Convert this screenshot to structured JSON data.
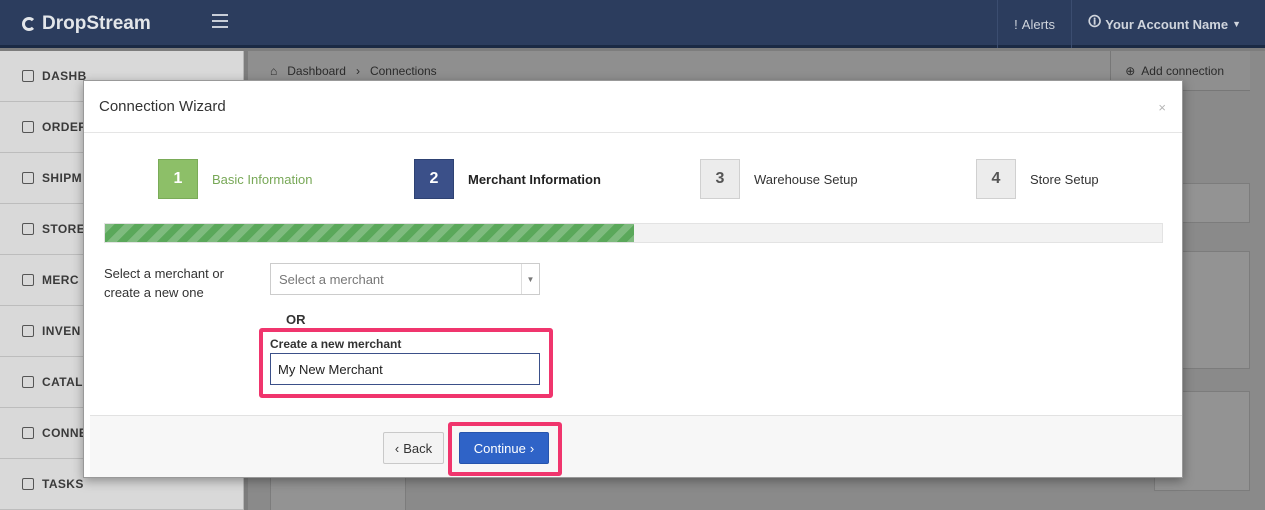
{
  "app": {
    "logo": "DropStream",
    "nav": {
      "alerts": "Alerts",
      "account": "Your Account Name"
    }
  },
  "sidebar": {
    "items": [
      {
        "label": "DASHB",
        "icon": "home-icon"
      },
      {
        "label": "ORDER",
        "icon": "bag-icon"
      },
      {
        "label": "SHIPM",
        "icon": "truck-icon"
      },
      {
        "label": "STORE",
        "icon": "cart-icon"
      },
      {
        "label": "MERC",
        "icon": "users-icon"
      },
      {
        "label": "INVEN",
        "icon": "inventory-icon"
      },
      {
        "label": "CATAL",
        "icon": "book-icon"
      },
      {
        "label": "CONNE",
        "icon": "plug-icon"
      },
      {
        "label": "TASKS",
        "icon": "list-icon"
      }
    ]
  },
  "breadcrumb": {
    "home": "Dashboard",
    "current": "Connections"
  },
  "actions": {
    "add_connection": "Add connection"
  },
  "modal": {
    "title": "Connection Wizard",
    "close": "×",
    "steps": [
      {
        "number": "1",
        "label": "Basic Information",
        "state": "done"
      },
      {
        "number": "2",
        "label": "Merchant Information",
        "state": "active"
      },
      {
        "number": "3",
        "label": "Warehouse Setup",
        "state": "pending"
      },
      {
        "number": "4",
        "label": "Store Setup",
        "state": "pending"
      }
    ],
    "progress_percent": 50,
    "merchant_label": "Select a merchant or create a new one",
    "merchant_select": {
      "placeholder": "Select a merchant"
    },
    "or_label": "OR",
    "new_merchant": {
      "label": "Create a new merchant",
      "value": "My New Merchant"
    },
    "buttons": {
      "back": "Back",
      "continue": "Continue"
    }
  },
  "colors": {
    "navbar": "#2c3d5e",
    "step_done": "#8dbf68",
    "step_active": "#3b5089",
    "progress": "#5aa85a",
    "highlight": "#f0356d",
    "primary_button": "#2f63c7"
  }
}
